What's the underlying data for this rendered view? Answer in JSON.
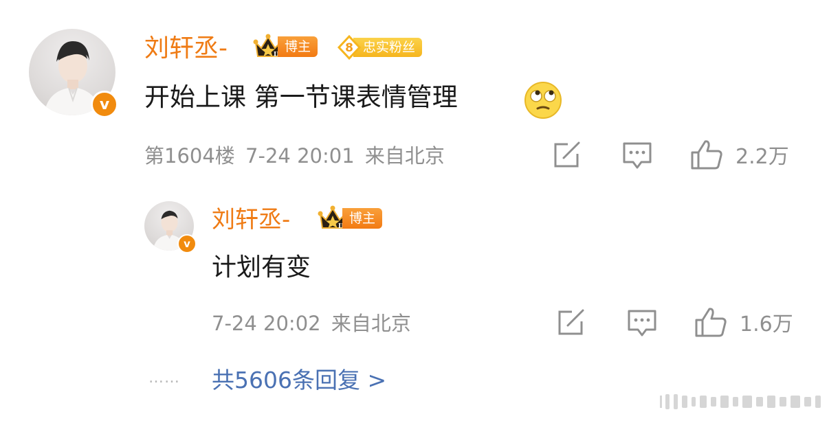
{
  "comment": {
    "username": "刘轩丞-",
    "blogger_badge": "博主",
    "fan_badge_level": "8",
    "fan_badge_label": "忠实粉丝",
    "verified_mark": "v",
    "text": "开始上课 第一节课表情管理",
    "floor": "第1604楼",
    "time": "7-24 20:01",
    "location": "来自北京",
    "likes": "2.2万"
  },
  "reply": {
    "username": "刘轩丞-",
    "blogger_badge": "博主",
    "verified_mark": "v",
    "text": "计划有变",
    "time": "7-24 20:02",
    "location": "来自北京",
    "likes": "1.6万"
  },
  "more_replies": {
    "dots": "……",
    "label": "共5606条回复 >"
  },
  "icons": {
    "share": "share-icon",
    "comment": "comment-icon",
    "like": "like-icon",
    "emoji": "rolling-eyes-emoji-icon",
    "crown": "crown-icon"
  },
  "colors": {
    "name": "#ef7b14",
    "meta": "#8f8f8f",
    "link": "#4a71b3",
    "blogger_badge": "#f27a13",
    "fan_badge": "#f6b51e"
  }
}
